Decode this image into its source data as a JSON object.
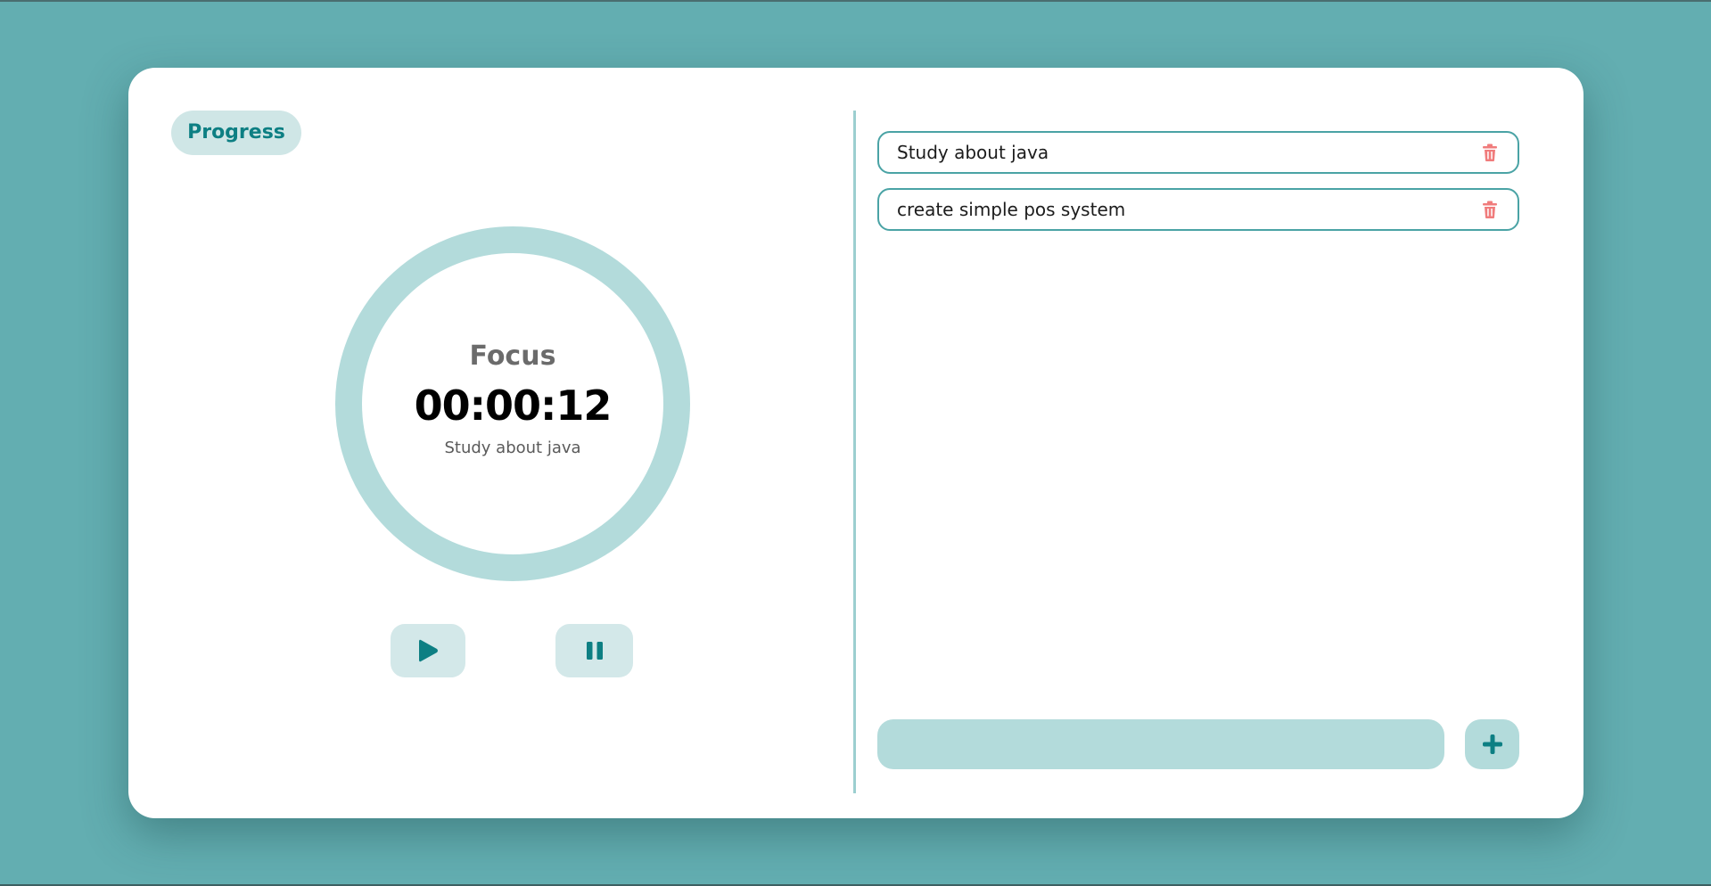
{
  "colors": {
    "background": "#63aeb1",
    "card": "#ffffff",
    "accent": "#0d7f83",
    "ring": "#b3dbdb",
    "button_bg": "#d3e8e9",
    "task_border": "#4aa3a5",
    "delete": "#f07c7c"
  },
  "header": {
    "progress_label": "Progress"
  },
  "timer": {
    "mode": "Focus",
    "time": "00:00:12",
    "current_task": "Study about java"
  },
  "controls": {
    "play_icon": "play-icon",
    "pause_icon": "pause-icon"
  },
  "tasks": [
    {
      "text": "Study about java",
      "delete_icon": "trash-icon"
    },
    {
      "text": "create simple pos system",
      "delete_icon": "trash-icon"
    }
  ],
  "new_task": {
    "value": "",
    "placeholder": "",
    "add_icon": "plus-icon"
  }
}
